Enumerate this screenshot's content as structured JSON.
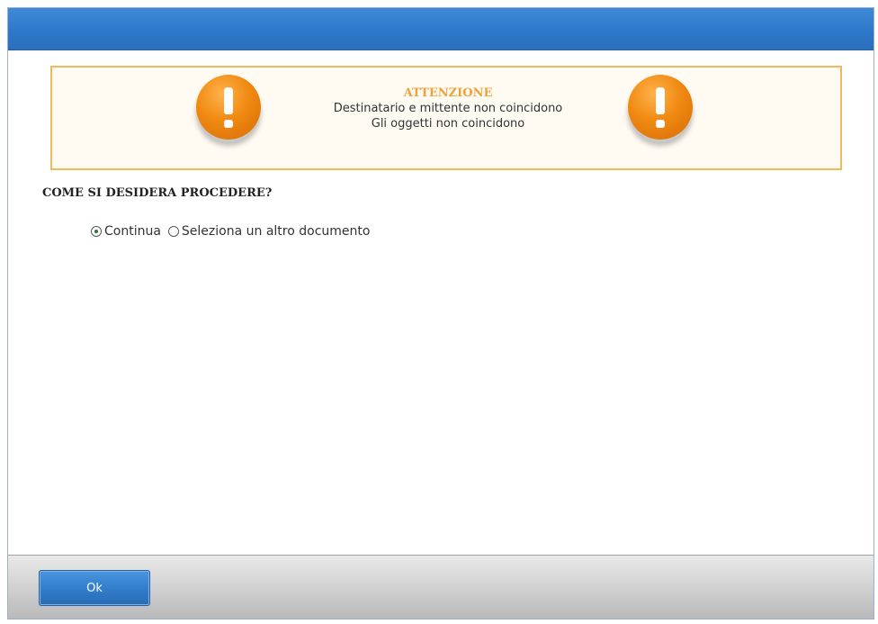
{
  "dialog": {
    "alert": {
      "title": "ATTENZIONE",
      "lines": [
        "Destinatario e mittente non coincidono",
        "Gli oggetti non coincidono"
      ],
      "icon": "warning-exclamation-icon",
      "accent_color": "#f0a23a"
    },
    "question": "COME SI DESIDERA PROCEDERE?",
    "options": [
      {
        "label": "Continua",
        "selected": true
      },
      {
        "label": "Seleziona un altro documento",
        "selected": false
      }
    ],
    "footer": {
      "ok_label": "Ok"
    },
    "colors": {
      "titlebar": "#2e78c9",
      "button": "#2f7ac9"
    }
  }
}
